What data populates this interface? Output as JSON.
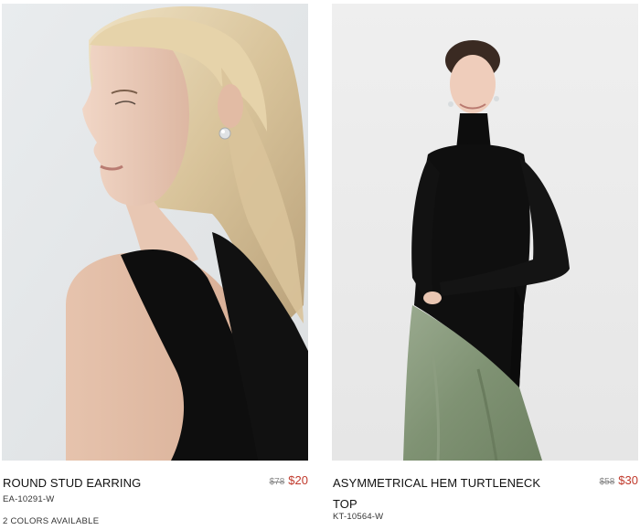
{
  "products": [
    {
      "name": "ROUND STUD EARRING",
      "old_price": "$78",
      "new_price": "$20",
      "sku": "EA-10291-W",
      "colors_note": "2 COLORS AVAILABLE",
      "image": "model-profile-stud-earring-photo"
    },
    {
      "name": "ASYMMETRICAL HEM TURTLENECK TOP",
      "old_price": "$58",
      "new_price": "$30",
      "sku": "KT-10564-W",
      "image": "model-turtleneck-green-skirt-photo"
    }
  ],
  "colors": {
    "sale_red": "#c0392b",
    "strike_gray": "#8a8a8a",
    "text": "#111111"
  }
}
